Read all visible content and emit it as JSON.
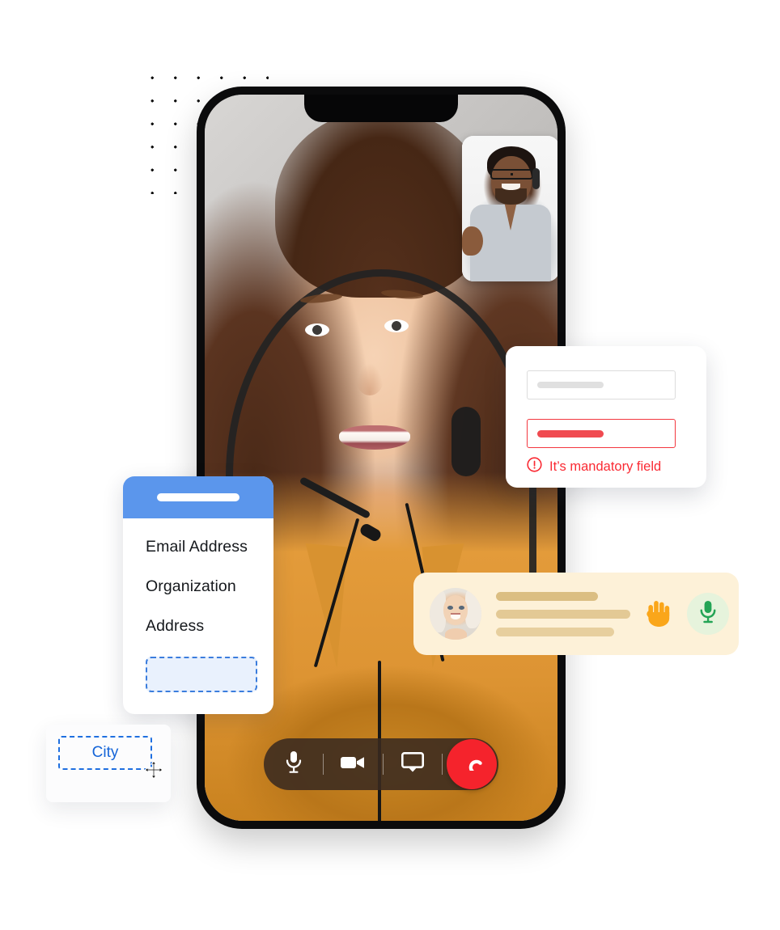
{
  "scene": {
    "title": "Video call with in-app form builder overlays",
    "background_color": "#ffffff"
  },
  "decor": {
    "dot_grid": {
      "name": "dot-grid",
      "rows": 6,
      "cols": 6,
      "dot_color": "#111111",
      "spacing_px": 28
    }
  },
  "phone": {
    "frame_color": "#0b0b0c",
    "main_video": {
      "participant": "Female support agent with headset",
      "background": "office"
    },
    "pip_video": {
      "participant": "Male support agent with glasses and headset"
    },
    "call_bar": {
      "background_color": "#3a2a20",
      "controls": [
        {
          "name": "microphone-button",
          "icon": "microphone-icon",
          "label": "Mute"
        },
        {
          "name": "video-button",
          "icon": "video-camera-icon",
          "label": "Camera"
        },
        {
          "name": "screen-share-button",
          "icon": "airplay-icon",
          "label": "Share screen"
        }
      ],
      "end_call": {
        "name": "end-call-button",
        "icon": "phone-hangup-icon",
        "label": "End call",
        "color": "#f5232c"
      }
    }
  },
  "form_card": {
    "header": {
      "accent_color": "#5b96ec",
      "placeholder_pill": true
    },
    "fields": [
      {
        "label": "Email Address"
      },
      {
        "label": "Organization"
      },
      {
        "label": "Address"
      }
    ],
    "drop_zone": {
      "label": "",
      "border_color": "#3b7ddd",
      "fill_color": "#e9f1fd"
    }
  },
  "validation_card": {
    "inputs": [
      {
        "name": "valid-input",
        "state": "normal",
        "value": "",
        "placeholder": "",
        "border_color": "#dcdcdc"
      },
      {
        "name": "invalid-input",
        "state": "error",
        "value": "",
        "placeholder": "",
        "border_color": "#f3373f"
      }
    ],
    "error": {
      "icon": "exclamation-circle-icon",
      "text": "It’s mandatory field",
      "color": "#fa2a33"
    }
  },
  "speaking_bar": {
    "background_color": "#fdf1d8",
    "avatar": {
      "name": "avatar",
      "participant": "Senior woman smiling"
    },
    "message_lines": 3,
    "line_color": "#dbbe82",
    "actions": [
      {
        "name": "raise-hand-button",
        "icon": "raised-hand-icon",
        "color": "#faa61a"
      },
      {
        "name": "unmute-button",
        "icon": "microphone-icon",
        "color": "#23a455",
        "background_color": "#e6f3dc"
      }
    ]
  },
  "city_field": {
    "label": "City",
    "text_color": "#1464d8",
    "border_color": "#1f6fe0",
    "border_style": "dashed",
    "cursor": "move-cursor-icon"
  }
}
